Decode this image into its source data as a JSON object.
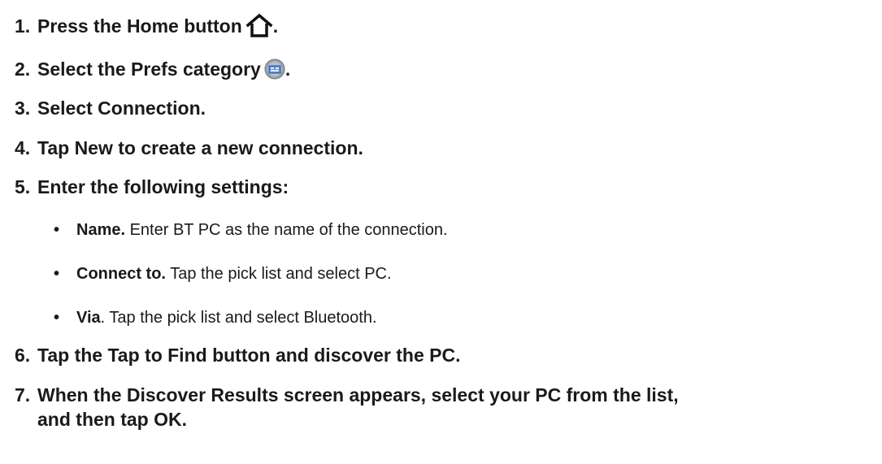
{
  "steps": [
    {
      "num": "1.",
      "text": "Press the Home button",
      "suffix": ".",
      "icon": "home-icon"
    },
    {
      "num": "2.",
      "text": "Select the Prefs category",
      "suffix": ".",
      "icon": "prefs-icon"
    },
    {
      "num": "3.",
      "text": "Select Connection."
    },
    {
      "num": "4.",
      "text": "Tap New to create a new connection."
    },
    {
      "num": "5.",
      "text": "Enter the following settings:"
    },
    {
      "num": "6.",
      "text": "Tap the Tap to Find button and discover the PC."
    },
    {
      "num": "7.",
      "text": "When the Discover Results screen appears, select your PC from the list,",
      "text2": "and then tap OK."
    }
  ],
  "settings": [
    {
      "bullet": "•",
      "term": "Name.",
      "desc": " Enter BT PC as the name of the connection."
    },
    {
      "bullet": "•",
      "term": "Connect to.",
      "desc": " Tap the pick list and select PC."
    },
    {
      "bullet": "•",
      "term": "Via",
      "desc": ". Tap the pick list and select Bluetooth."
    }
  ]
}
